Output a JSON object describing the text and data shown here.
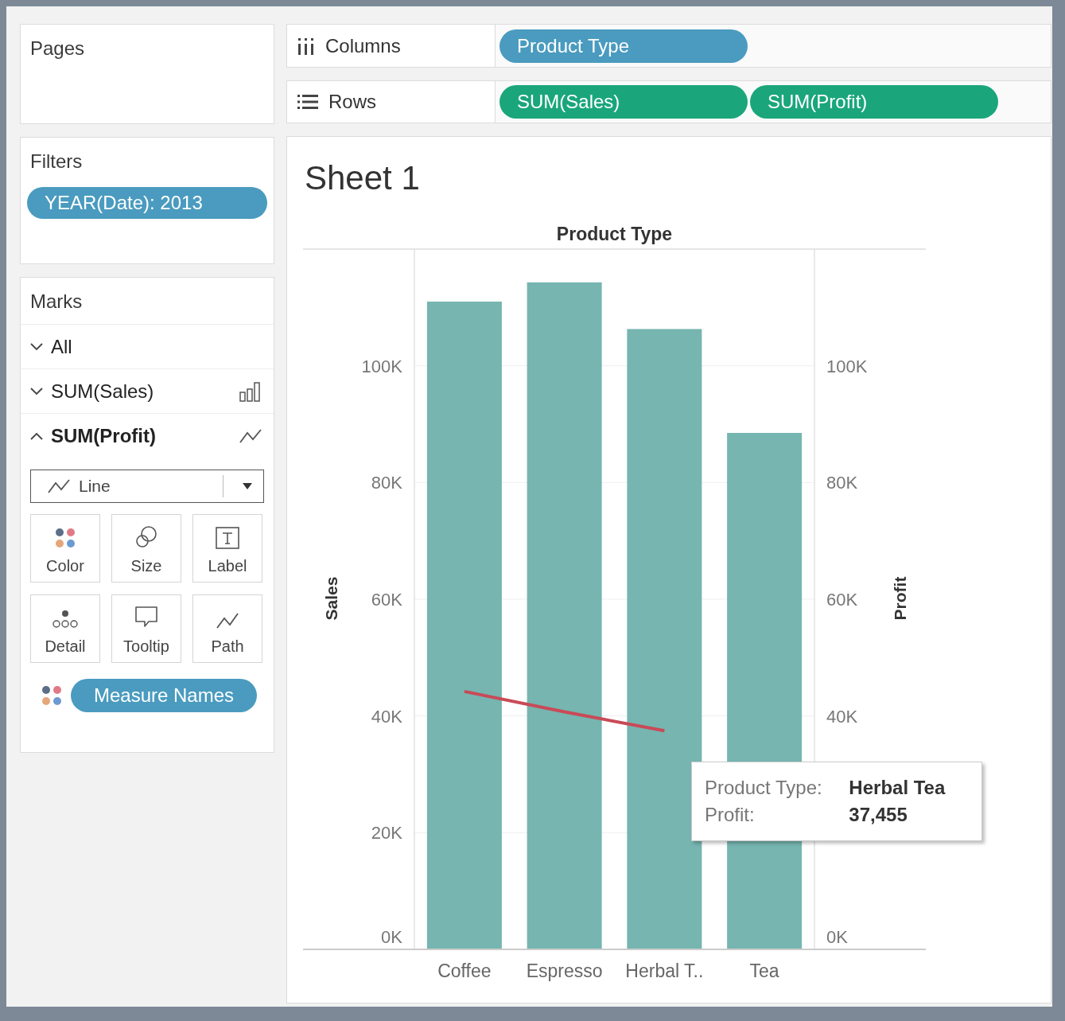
{
  "pages": {
    "title": "Pages"
  },
  "filters": {
    "title": "Filters",
    "pills": [
      {
        "label": "YEAR(Date): 2013",
        "color": "#4a9bbf"
      }
    ]
  },
  "marks": {
    "title": "Marks",
    "layers": [
      {
        "label": "All",
        "expanded": false
      },
      {
        "label": "SUM(Sales)",
        "expanded": false,
        "kind": "bar"
      },
      {
        "label": "SUM(Profit)",
        "expanded": true,
        "kind": "line"
      }
    ],
    "mark_type": {
      "label": "Line",
      "kind": "line"
    },
    "cards": [
      {
        "label": "Color",
        "kind": "color"
      },
      {
        "label": "Size",
        "kind": "size"
      },
      {
        "label": "Label",
        "kind": "label"
      },
      {
        "label": "Detail",
        "kind": "detail"
      },
      {
        "label": "Tooltip",
        "kind": "tooltip"
      },
      {
        "label": "Path",
        "kind": "path"
      }
    ],
    "fields": [
      {
        "label": "Measure Names",
        "kind": "color",
        "color": "#4a9bbf"
      }
    ]
  },
  "shelves": [
    {
      "label": "Columns",
      "kind": "columns",
      "pills": [
        {
          "label": "Product Type",
          "color": "#4a9bbf"
        }
      ]
    },
    {
      "label": "Rows",
      "kind": "rows",
      "pills": [
        {
          "label": "SUM(Sales)",
          "color": "#1aa67a"
        },
        {
          "label": "SUM(Profit)",
          "color": "#1aa67a"
        }
      ]
    }
  ],
  "sheet": {
    "title": "Sheet 1",
    "chart_data": {
      "type": "bar",
      "title": "Product Type",
      "ylabel": "Sales",
      "y2label": "Profit",
      "categories": [
        "Coffee",
        "Espresso",
        "Herbal T..",
        "Tea"
      ],
      "ylim": [
        0,
        120000
      ],
      "grid": true,
      "yticks": [
        {
          "value": 0,
          "label": "0K"
        },
        {
          "value": 20000,
          "label": "20K"
        },
        {
          "value": 40000,
          "label": "40K"
        },
        {
          "value": 60000,
          "label": "60K"
        },
        {
          "value": 80000,
          "label": "80K"
        },
        {
          "value": 100000,
          "label": "100K"
        }
      ],
      "series": [
        {
          "type": "bar",
          "color": "#76b5b0",
          "values": [
            111000,
            114300,
            106300,
            88500
          ]
        },
        {
          "type": "line",
          "color": "#c94a57",
          "values": [
            44200,
            40700,
            37455,
            null
          ]
        }
      ]
    },
    "tooltip": {
      "rows": [
        {
          "label": "Product Type:",
          "value": "Herbal Tea"
        },
        {
          "label": "Profit:",
          "value": "37,455"
        }
      ]
    }
  }
}
